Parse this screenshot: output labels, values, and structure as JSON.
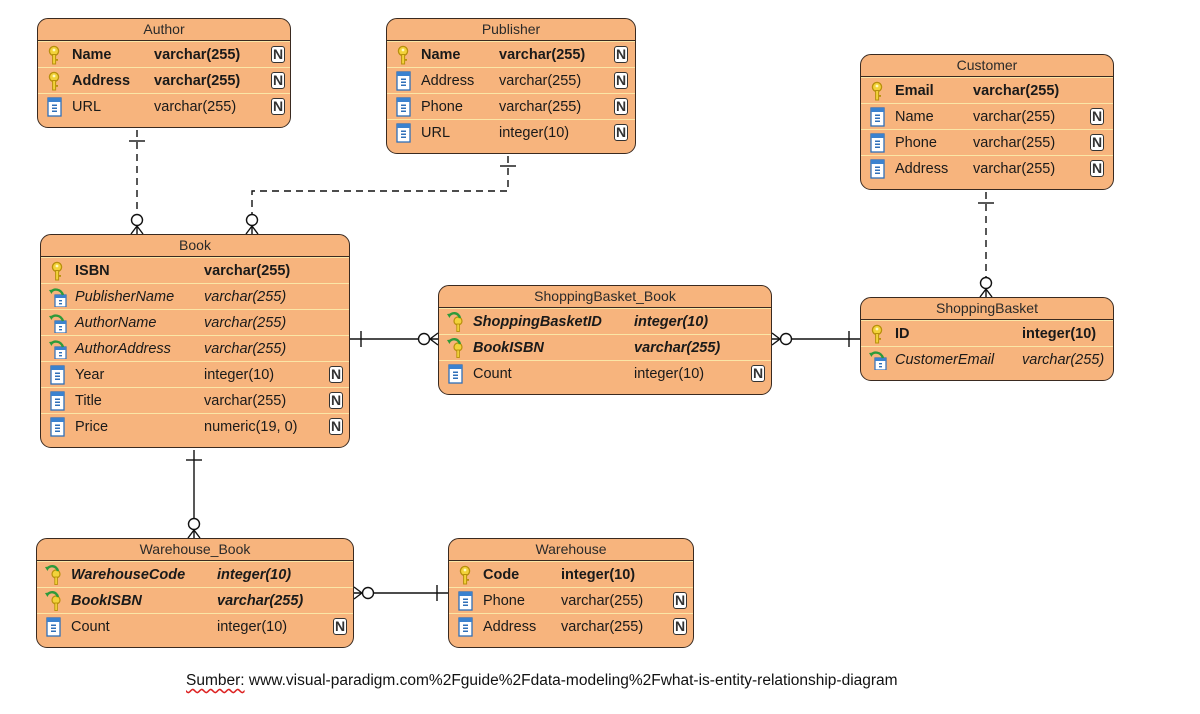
{
  "diagram_type": "Entity Relationship Diagram",
  "colors": {
    "entity_fill": "#f7b47d",
    "entity_border": "#3a2a20",
    "row_separator": "#fbe6a6",
    "key_icon": "#e8c020",
    "column_icon": "#3b7fc4",
    "fk_arrow": "#2e9a3a"
  },
  "entities": {
    "author": {
      "name": "Author",
      "columns": [
        {
          "name": "Name",
          "type": "varchar(255)",
          "key": "pk",
          "nullable": true
        },
        {
          "name": "Address",
          "type": "varchar(255)",
          "key": "pk",
          "nullable": true
        },
        {
          "name": "URL",
          "type": "varchar(255)",
          "key": "none",
          "nullable": true
        }
      ]
    },
    "publisher": {
      "name": "Publisher",
      "columns": [
        {
          "name": "Name",
          "type": "varchar(255)",
          "key": "pk",
          "nullable": true
        },
        {
          "name": "Address",
          "type": "varchar(255)",
          "key": "none",
          "nullable": true
        },
        {
          "name": "Phone",
          "type": "varchar(255)",
          "key": "none",
          "nullable": true
        },
        {
          "name": "URL",
          "type": "integer(10)",
          "key": "none",
          "nullable": true
        }
      ]
    },
    "customer": {
      "name": "Customer",
      "columns": [
        {
          "name": "Email",
          "type": "varchar(255)",
          "key": "pk",
          "nullable": false
        },
        {
          "name": "Name",
          "type": "varchar(255)",
          "key": "none",
          "nullable": true
        },
        {
          "name": "Phone",
          "type": "varchar(255)",
          "key": "none",
          "nullable": true
        },
        {
          "name": "Address",
          "type": "varchar(255)",
          "key": "none",
          "nullable": true
        }
      ]
    },
    "book": {
      "name": "Book",
      "columns": [
        {
          "name": "ISBN",
          "type": "varchar(255)",
          "key": "pk",
          "nullable": false
        },
        {
          "name": "PublisherName",
          "type": "varchar(255)",
          "key": "fk",
          "nullable": false
        },
        {
          "name": "AuthorName",
          "type": "varchar(255)",
          "key": "fk",
          "nullable": false
        },
        {
          "name": "AuthorAddress",
          "type": "varchar(255)",
          "key": "fk",
          "nullable": false
        },
        {
          "name": "Year",
          "type": "integer(10)",
          "key": "none",
          "nullable": true
        },
        {
          "name": "Title",
          "type": "varchar(255)",
          "key": "none",
          "nullable": true
        },
        {
          "name": "Price",
          "type": "numeric(19, 0)",
          "key": "none",
          "nullable": true
        }
      ]
    },
    "shoppingbasket_book": {
      "name": "ShoppingBasket_Book",
      "columns": [
        {
          "name": "ShoppingBasketID",
          "type": "integer(10)",
          "key": "pfk",
          "nullable": false
        },
        {
          "name": "BookISBN",
          "type": "varchar(255)",
          "key": "pfk",
          "nullable": false
        },
        {
          "name": "Count",
          "type": "integer(10)",
          "key": "none",
          "nullable": true
        }
      ]
    },
    "shoppingbasket": {
      "name": "ShoppingBasket",
      "columns": [
        {
          "name": "ID",
          "type": "integer(10)",
          "key": "pk",
          "nullable": false
        },
        {
          "name": "CustomerEmail",
          "type": "varchar(255)",
          "key": "fk",
          "nullable": false
        }
      ]
    },
    "warehouse_book": {
      "name": "Warehouse_Book",
      "columns": [
        {
          "name": "WarehouseCode",
          "type": "integer(10)",
          "key": "pfk",
          "nullable": false
        },
        {
          "name": "BookISBN",
          "type": "varchar(255)",
          "key": "pfk",
          "nullable": false
        },
        {
          "name": "Count",
          "type": "integer(10)",
          "key": "none",
          "nullable": true
        }
      ]
    },
    "warehouse": {
      "name": "Warehouse",
      "columns": [
        {
          "name": "Code",
          "type": "integer(10)",
          "key": "pk",
          "nullable": false
        },
        {
          "name": "Phone",
          "type": "varchar(255)",
          "key": "none",
          "nullable": true
        },
        {
          "name": "Address",
          "type": "varchar(255)",
          "key": "none",
          "nullable": true
        }
      ]
    }
  },
  "relationships": [
    {
      "from": "Author",
      "to": "Book",
      "from_card": "one",
      "to_card": "zero-or-many",
      "style": "dashed"
    },
    {
      "from": "Publisher",
      "to": "Book",
      "from_card": "one",
      "to_card": "zero-or-many",
      "style": "dashed"
    },
    {
      "from": "Customer",
      "to": "ShoppingBasket",
      "from_card": "one",
      "to_card": "zero-or-many",
      "style": "dashed"
    },
    {
      "from": "Book",
      "to": "ShoppingBasket_Book",
      "from_card": "one",
      "to_card": "zero-or-many",
      "style": "solid"
    },
    {
      "from": "ShoppingBasket",
      "to": "ShoppingBasket_Book",
      "from_card": "one",
      "to_card": "zero-or-many",
      "style": "solid"
    },
    {
      "from": "Book",
      "to": "Warehouse_Book",
      "from_card": "one",
      "to_card": "zero-or-many",
      "style": "solid"
    },
    {
      "from": "Warehouse",
      "to": "Warehouse_Book",
      "from_card": "one",
      "to_card": "zero-or-many",
      "style": "solid"
    }
  ],
  "null_marker": "N",
  "source": {
    "label": "Sumber:",
    "text": " www.visual-paradigm.com%2Fguide%2Fdata-modeling%2Fwhat-is-entity-relationship-diagram"
  }
}
